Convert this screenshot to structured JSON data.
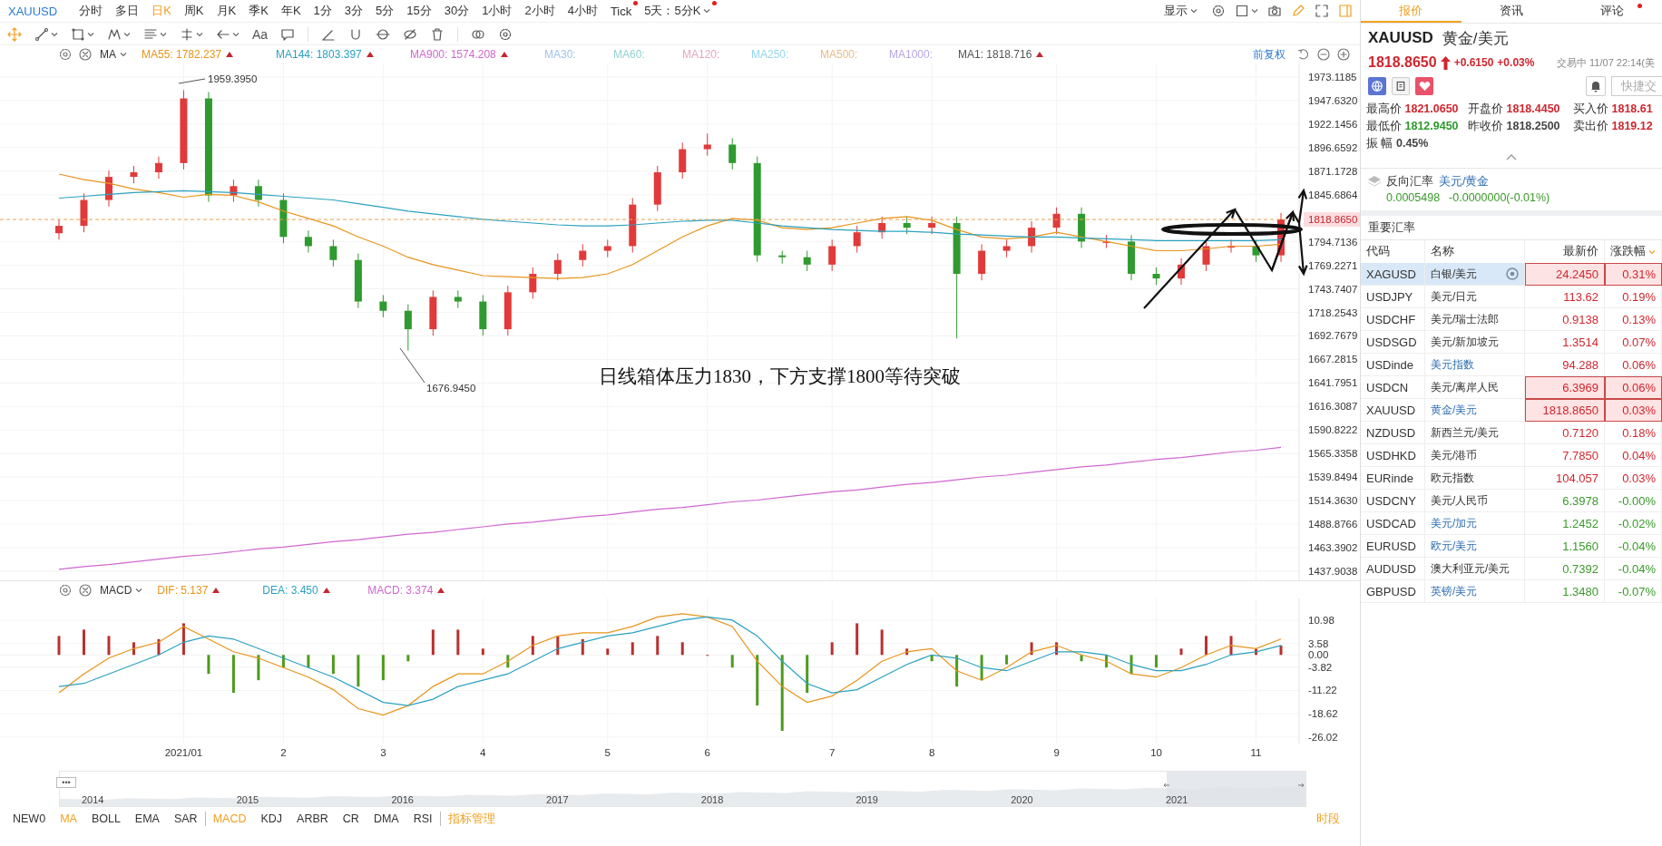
{
  "toolbar": {
    "symbol": "XAUUSD",
    "periods": [
      {
        "label": "分时",
        "selected": false,
        "badge": false,
        "dropdown": false
      },
      {
        "label": "多日",
        "selected": false,
        "badge": false,
        "dropdown": false
      },
      {
        "label": "日K",
        "selected": true,
        "badge": false,
        "dropdown": false
      },
      {
        "label": "周K",
        "selected": false,
        "badge": false,
        "dropdown": false
      },
      {
        "label": "月K",
        "selected": false,
        "badge": false,
        "dropdown": false
      },
      {
        "label": "季K",
        "selected": false,
        "badge": false,
        "dropdown": false
      },
      {
        "label": "年K",
        "selected": false,
        "badge": false,
        "dropdown": false
      },
      {
        "label": "1分",
        "selected": false,
        "badge": false,
        "dropdown": false
      },
      {
        "label": "3分",
        "selected": false,
        "badge": false,
        "dropdown": false
      },
      {
        "label": "5分",
        "selected": false,
        "badge": false,
        "dropdown": false
      },
      {
        "label": "15分",
        "selected": false,
        "badge": false,
        "dropdown": false
      },
      {
        "label": "30分",
        "selected": false,
        "badge": false,
        "dropdown": false
      },
      {
        "label": "1小时",
        "selected": false,
        "badge": false,
        "dropdown": false
      },
      {
        "label": "2小时",
        "selected": false,
        "badge": false,
        "dropdown": false
      },
      {
        "label": "4小时",
        "selected": false,
        "badge": false,
        "dropdown": false
      },
      {
        "label": "Tick",
        "selected": false,
        "badge": true,
        "dropdown": false
      },
      {
        "label": "5天：5分K",
        "selected": false,
        "badge": true,
        "dropdown": true
      }
    ],
    "display_label": "显示",
    "text_tool_label": "Aa"
  },
  "chart": {
    "legend": {
      "indicator": "MA",
      "items": [
        {
          "label": "MA55: 1782.237",
          "color": "#e8941a",
          "active": true
        },
        {
          "label": "MA144: 1803.397",
          "color": "#2aa1c0",
          "active": true
        },
        {
          "label": "MA900: 1574.208",
          "color": "#d067d0",
          "active": true
        },
        {
          "label": "MA30:",
          "color": "#9fc2e8",
          "active": false
        },
        {
          "label": "MA60:",
          "color": "#94cfcf",
          "active": false
        },
        {
          "label": "MA120:",
          "color": "#e9a3bb",
          "active": false
        },
        {
          "label": "MA250:",
          "color": "#94d6ec",
          "active": false
        },
        {
          "label": "MA500:",
          "color": "#e9bc86",
          "active": false
        },
        {
          "label": "MA1000:",
          "color": "#b7a6e3",
          "active": false
        },
        {
          "label": "MA1: 1818.716",
          "color": "#555555",
          "active": true
        }
      ]
    },
    "adjust_label": "前复权",
    "high_label": "1959.3950",
    "low_label": "1676.9450",
    "note": "日线箱体压力1830，下方支撑1800等待突破",
    "chart_data": {
      "type": "candlestick",
      "grid": true,
      "categories": [
        null,
        null,
        null,
        null,
        null,
        null,
        null,
        null,
        null,
        null,
        null,
        null,
        null,
        null,
        null,
        null,
        null,
        null,
        null,
        null,
        null,
        null,
        null,
        null,
        null,
        null,
        null,
        null,
        null,
        null,
        null,
        null,
        null,
        null,
        null,
        null,
        null,
        null,
        null,
        null,
        null,
        null,
        null,
        null,
        null,
        null,
        null,
        null,
        null,
        null
      ],
      "ylim": [
        1428.05,
        1987.85
      ],
      "yticks": [
        {
          "value": 1973.1185,
          "label": "1973.1185"
        },
        {
          "value": 1947.632,
          "label": "1947.6320"
        },
        {
          "value": 1922.1456,
          "label": "1922.1456"
        },
        {
          "value": 1896.6592,
          "label": "1896.6592"
        },
        {
          "value": 1871.1728,
          "label": "1871.1728"
        },
        {
          "value": 1845.6864,
          "label": "1845.6864"
        },
        {
          "value": 1794.7136,
          "label": "1794.7136"
        },
        {
          "value": 1769.2271,
          "label": "1769.2271"
        },
        {
          "value": 1743.7407,
          "label": "1743.7407"
        },
        {
          "value": 1718.2543,
          "label": "1718.2543"
        },
        {
          "value": 1692.7679,
          "label": "1692.7679"
        },
        {
          "value": 1667.2815,
          "label": "1667.2815"
        },
        {
          "value": 1641.7951,
          "label": "1641.7951"
        },
        {
          "value": 1616.3087,
          "label": "1616.3087"
        },
        {
          "value": 1590.8222,
          "label": "1590.8222"
        },
        {
          "value": 1565.3358,
          "label": "1565.3358"
        },
        {
          "value": 1539.8494,
          "label": "1539.8494"
        },
        {
          "value": 1514.363,
          "label": "1514.3630"
        },
        {
          "value": 1488.8766,
          "label": "1488.8766"
        },
        {
          "value": 1463.3902,
          "label": "1463.3902"
        },
        {
          "value": 1437.9038,
          "label": "1437.9038"
        }
      ],
      "ref_lines": [
        {
          "axis": "y",
          "value": 1818.865,
          "label": "1818.8650",
          "color": "#e8a050"
        }
      ],
      "ohlc": [
        [
          1804,
          1819,
          1797,
          1812
        ],
        [
          1812,
          1847,
          1805,
          1840
        ],
        [
          1840,
          1872,
          1833,
          1865
        ],
        [
          1865,
          1877,
          1858,
          1870
        ],
        [
          1870,
          1887,
          1863,
          1880
        ],
        [
          1880,
          1959,
          1873,
          1950
        ],
        [
          1950,
          1957,
          1838,
          1845
        ],
        [
          1845,
          1862,
          1838,
          1855
        ],
        [
          1855,
          1862,
          1833,
          1840
        ],
        [
          1840,
          1847,
          1793,
          1800
        ],
        [
          1800,
          1807,
          1783,
          1790
        ],
        [
          1790,
          1797,
          1768,
          1775
        ],
        [
          1775,
          1782,
          1723,
          1730
        ],
        [
          1730,
          1737,
          1713,
          1720
        ],
        [
          1720,
          1727,
          1677,
          1700
        ],
        [
          1700,
          1742,
          1693,
          1735
        ],
        [
          1735,
          1742,
          1723,
          1730
        ],
        [
          1730,
          1737,
          1693,
          1700
        ],
        [
          1700,
          1747,
          1693,
          1740
        ],
        [
          1740,
          1767,
          1733,
          1760
        ],
        [
          1760,
          1782,
          1753,
          1775
        ],
        [
          1775,
          1792,
          1768,
          1785
        ],
        [
          1785,
          1797,
          1778,
          1790
        ],
        [
          1790,
          1842,
          1783,
          1835
        ],
        [
          1835,
          1877,
          1828,
          1870
        ],
        [
          1870,
          1902,
          1863,
          1895
        ],
        [
          1895,
          1912,
          1888,
          1900
        ],
        [
          1900,
          1907,
          1873,
          1880
        ],
        [
          1880,
          1887,
          1773,
          1780
        ],
        [
          1780,
          1785,
          1771,
          1778
        ],
        [
          1778,
          1785,
          1763,
          1770
        ],
        [
          1770,
          1797,
          1763,
          1790
        ],
        [
          1790,
          1812,
          1783,
          1805
        ],
        [
          1805,
          1822,
          1798,
          1815
        ],
        [
          1815,
          1822,
          1803,
          1810
        ],
        [
          1810,
          1822,
          1803,
          1815
        ],
        [
          1815,
          1822,
          1690,
          1760
        ],
        [
          1760,
          1792,
          1753,
          1785
        ],
        [
          1785,
          1797,
          1778,
          1790
        ],
        [
          1790,
          1817,
          1783,
          1810
        ],
        [
          1810,
          1832,
          1803,
          1825
        ],
        [
          1825,
          1832,
          1788,
          1795
        ],
        [
          1795,
          1802,
          1788,
          1795
        ],
        [
          1795,
          1802,
          1753,
          1760
        ],
        [
          1760,
          1767,
          1748,
          1755
        ],
        [
          1755,
          1777,
          1748,
          1770
        ],
        [
          1770,
          1797,
          1763,
          1790
        ],
        [
          1790,
          1797,
          1783,
          1790
        ],
        [
          1790,
          1797,
          1773,
          1780
        ],
        [
          1780,
          1826,
          1773,
          1819
        ]
      ],
      "series": [
        {
          "type": "line",
          "color": "#e8941a",
          "values": [
            1868,
            1862,
            1858,
            1852,
            1848,
            1843,
            1846,
            1845,
            1838,
            1828,
            1820,
            1812,
            1800,
            1790,
            1778,
            1770,
            1764,
            1758,
            1757,
            1756,
            1755,
            1756,
            1760,
            1770,
            1785,
            1800,
            1812,
            1820,
            1818,
            1810,
            1808,
            1810,
            1815,
            1820,
            1822,
            1818,
            1808,
            1800,
            1798,
            1800,
            1805,
            1800,
            1795,
            1790,
            1785,
            1785,
            1787,
            1790,
            1790,
            1792
          ]
        },
        {
          "type": "line",
          "color": "#2aa1c0",
          "values": [
            1842,
            1844,
            1846,
            1848,
            1849,
            1850,
            1849,
            1848,
            1846,
            1844,
            1842,
            1840,
            1836,
            1832,
            1828,
            1825,
            1822,
            1819,
            1817,
            1815,
            1813,
            1812,
            1812,
            1813,
            1815,
            1817,
            1818,
            1818,
            1815,
            1812,
            1810,
            1808,
            1807,
            1806,
            1806,
            1805,
            1803,
            1802,
            1801,
            1800,
            1800,
            1799,
            1798,
            1797,
            1796,
            1796,
            1796,
            1796,
            1796,
            1797
          ]
        },
        {
          "type": "line",
          "color": "#d067d0",
          "values": [
            1440,
            1443,
            1445,
            1448,
            1451,
            1454,
            1456,
            1459,
            1462,
            1464,
            1467,
            1470,
            1472,
            1475,
            1478,
            1480,
            1483,
            1486,
            1489,
            1491,
            1494,
            1497,
            1499,
            1502,
            1505,
            1507,
            1510,
            1513,
            1515,
            1518,
            1521,
            1524,
            1526,
            1529,
            1532,
            1534,
            1537,
            1540,
            1542,
            1545,
            1548,
            1551,
            1553,
            1556,
            1559,
            1561,
            1564,
            1567,
            1569,
            1572
          ]
        }
      ]
    }
  },
  "macd": {
    "legend": {
      "indicator": "MACD",
      "items": [
        {
          "label": "DIF: 5.137",
          "color": "#e8941a",
          "active": true
        },
        {
          "label": "DEA: 3.450",
          "color": "#2aa1c0",
          "active": true
        },
        {
          "label": "MACD: 3.374",
          "color": "#d067d0",
          "active": true
        }
      ]
    },
    "chart_data": {
      "type": "bar",
      "grid": true,
      "categories": [
        null,
        null,
        null,
        null,
        null,
        "2021/01",
        null,
        null,
        null,
        "2",
        null,
        null,
        null,
        "3",
        null,
        null,
        null,
        "4",
        null,
        null,
        null,
        null,
        "5",
        null,
        null,
        null,
        "6",
        null,
        null,
        null,
        null,
        "7",
        null,
        null,
        null,
        "8",
        null,
        null,
        null,
        null,
        "9",
        null,
        null,
        null,
        "10",
        null,
        null,
        null,
        "11",
        null
      ],
      "ylim": [
        -28.03,
        17.86
      ],
      "yticks": [
        {
          "value": 10.98,
          "label": "10.98"
        },
        {
          "value": 3.58,
          "label": "3.58"
        },
        {
          "value": 0,
          "label": "0.00"
        },
        {
          "value": -3.82,
          "label": "-3.82"
        },
        {
          "value": -11.22,
          "label": "-11.22"
        },
        {
          "value": -18.62,
          "label": "-18.62"
        },
        {
          "value": -26.02,
          "label": "-26.02"
        }
      ],
      "series": [
        {
          "type": "bar",
          "color": "#b8312f",
          "values": [
            6,
            8,
            6,
            4,
            5,
            10,
            null,
            null,
            null,
            null,
            null,
            null,
            null,
            null,
            null,
            8,
            8,
            2,
            null,
            6,
            6,
            5,
            2,
            4,
            6,
            4,
            0,
            null,
            null,
            null,
            null,
            4,
            10,
            8,
            2,
            null,
            null,
            null,
            null,
            4,
            4,
            null,
            null,
            null,
            null,
            2,
            6,
            6,
            2,
            3
          ]
        },
        {
          "type": "bar",
          "color": "#4f9a1e",
          "values": [
            null,
            null,
            null,
            null,
            null,
            null,
            -6,
            -12,
            -8,
            -4,
            -4,
            -6,
            -10,
            -8,
            -2,
            null,
            null,
            null,
            -4,
            null,
            null,
            null,
            null,
            null,
            null,
            null,
            null,
            -4,
            -16,
            -24,
            -12,
            null,
            null,
            null,
            null,
            -2,
            -10,
            -8,
            -3,
            null,
            null,
            -2,
            -4,
            -6,
            -4,
            null,
            null,
            null,
            null,
            null
          ]
        },
        {
          "type": "line",
          "color": "#e8941a",
          "values": [
            -12,
            -6,
            -1,
            2,
            4,
            9,
            5,
            1,
            -1,
            -4,
            -7,
            -11,
            -17,
            -19,
            -16,
            -10,
            -6,
            -6,
            -2,
            3,
            6,
            7,
            7,
            9,
            12,
            13,
            12,
            9,
            -2,
            -10,
            -15,
            -13,
            -8,
            -2,
            1,
            2,
            -5,
            -8,
            -4,
            1,
            3,
            0,
            -2,
            -6,
            -7,
            -4,
            0,
            3,
            2,
            5
          ]
        },
        {
          "type": "line",
          "color": "#2aa1c0",
          "values": [
            -10,
            -9,
            -6,
            -3,
            0,
            4,
            6,
            5,
            2,
            -1,
            -4,
            -7,
            -11,
            -15,
            -16,
            -14,
            -10,
            -8,
            -6,
            -2,
            2,
            4,
            6,
            7,
            9,
            11,
            12,
            11,
            6,
            -2,
            -9,
            -12,
            -11,
            -7,
            -3,
            0,
            -1,
            -4,
            -5,
            -2,
            1,
            1,
            0,
            -3,
            -5,
            -5,
            -3,
            0,
            1,
            3
          ]
        }
      ]
    }
  },
  "navigator": {
    "menu_label": "•••",
    "years": [
      "2014",
      "2015",
      "2016",
      "2017",
      "2018",
      "2019",
      "2020",
      "2021"
    ]
  },
  "indicator_bar": {
    "items": [
      {
        "label": "NEW0",
        "selected": false,
        "divider": false
      },
      {
        "label": "MA",
        "selected": true,
        "divider": false
      },
      {
        "label": "BOLL",
        "selected": false,
        "divider": false
      },
      {
        "label": "EMA",
        "selected": false,
        "divider": false
      },
      {
        "label": "SAR",
        "selected": false,
        "divider": false
      },
      {
        "label": "MACD",
        "selected": true,
        "divider": true
      },
      {
        "label": "KDJ",
        "selected": false,
        "divider": false
      },
      {
        "label": "ARBR",
        "selected": false,
        "divider": false
      },
      {
        "label": "CR",
        "selected": false,
        "divider": false
      },
      {
        "label": "DMA",
        "selected": false,
        "divider": false
      },
      {
        "label": "RSI",
        "selected": false,
        "divider": false
      }
    ],
    "manage_label": "指标管理",
    "session_label": "时段"
  },
  "side_panel": {
    "tabs": [
      {
        "label": "报价",
        "selected": true,
        "badge": false
      },
      {
        "label": "资讯",
        "selected": false,
        "badge": false
      },
      {
        "label": "评论",
        "selected": false,
        "badge": true
      }
    ],
    "symbol": "XAUUSD",
    "name": "黄金/美元",
    "price": "1818.8650",
    "rising": true,
    "change": "+0.6150",
    "change_pct": "+0.03%",
    "status": "交易中 11/07 22:14(美",
    "quick_trade": "快捷交",
    "stats": [
      {
        "label": "最高价",
        "value": "1821.0650",
        "color": "#d0262e"
      },
      {
        "label": "开盘价",
        "value": "1818.4450",
        "color": "#d0262e"
      },
      {
        "label": "买入价",
        "value": "1818.61",
        "color": "#d0262e"
      },
      {
        "label": "最低价",
        "value": "1812.9450",
        "color": "#2c9a2c"
      },
      {
        "label": "昨收价",
        "value": "1818.2500",
        "color": "#444444"
      },
      {
        "label": "卖出价",
        "value": "1819.12",
        "color": "#d0262e"
      },
      {
        "label": "振 幅",
        "value": "0.45%",
        "color": "#444444"
      }
    ],
    "reverse": {
      "label": "反向汇率",
      "pair": "美元/黄金",
      "rate": "0.0005498",
      "change": "-0.0000000(-0.01%)"
    },
    "rates": {
      "title": "重要汇率",
      "columns": [
        "代码",
        "名称",
        "最新价",
        "涨跌幅"
      ],
      "rows": [
        {
          "code": "XAGUSD",
          "name": "白银/美元",
          "price": "24.2450",
          "change": "0.31%",
          "rising": true,
          "selected": true,
          "highlighted": true,
          "linked": false
        },
        {
          "code": "USDJPY",
          "name": "美元/日元",
          "price": "113.62",
          "change": "0.19%",
          "rising": true,
          "selected": false,
          "highlighted": false,
          "linked": false
        },
        {
          "code": "USDCHF",
          "name": "美元/瑞士法郎",
          "price": "0.9138",
          "change": "0.13%",
          "rising": true,
          "selected": false,
          "highlighted": false,
          "linked": false
        },
        {
          "code": "USDSGD",
          "name": "美元/新加坡元",
          "price": "1.3514",
          "change": "0.07%",
          "rising": true,
          "selected": false,
          "highlighted": false,
          "linked": false
        },
        {
          "code": "USDinde",
          "name": "美元指数",
          "price": "94.288",
          "change": "0.06%",
          "rising": true,
          "selected": false,
          "highlighted": false,
          "linked": true
        },
        {
          "code": "USDCN",
          "name": "美元/离岸人民",
          "price": "6.3969",
          "change": "0.06%",
          "rising": true,
          "selected": false,
          "highlighted": true,
          "linked": false
        },
        {
          "code": "XAUUSD",
          "name": "黄金/美元",
          "price": "1818.8650",
          "change": "0.03%",
          "rising": true,
          "selected": false,
          "highlighted": true,
          "linked": true
        },
        {
          "code": "NZDUSD",
          "name": "新西兰元/美元",
          "price": "0.7120",
          "change": "0.18%",
          "rising": true,
          "selected": false,
          "highlighted": false,
          "linked": false
        },
        {
          "code": "USDHKD",
          "name": "美元/港币",
          "price": "7.7850",
          "change": "0.04%",
          "rising": true,
          "selected": false,
          "highlighted": false,
          "linked": false
        },
        {
          "code": "EURinde",
          "name": "欧元指数",
          "price": "104.057",
          "change": "0.03%",
          "rising": true,
          "selected": false,
          "highlighted": false,
          "linked": false
        },
        {
          "code": "USDCNY",
          "name": "美元/人民币",
          "price": "6.3978",
          "change": "-0.00%",
          "rising": false,
          "selected": false,
          "highlighted": false,
          "linked": false
        },
        {
          "code": "USDCAD",
          "name": "美元/加元",
          "price": "1.2452",
          "change": "-0.02%",
          "rising": false,
          "selected": false,
          "highlighted": false,
          "linked": true
        },
        {
          "code": "EURUSD",
          "name": "欧元/美元",
          "price": "1.1560",
          "change": "-0.04%",
          "rising": false,
          "selected": false,
          "highlighted": false,
          "linked": true
        },
        {
          "code": "AUDUSD",
          "name": "澳大利亚元/美元",
          "price": "0.7392",
          "change": "-0.04%",
          "rising": false,
          "selected": false,
          "highlighted": false,
          "linked": false
        },
        {
          "code": "GBPUSD",
          "name": "英镑/美元",
          "price": "1.3480",
          "change": "-0.07%",
          "rising": false,
          "selected": false,
          "highlighted": false,
          "linked": true
        }
      ]
    }
  }
}
